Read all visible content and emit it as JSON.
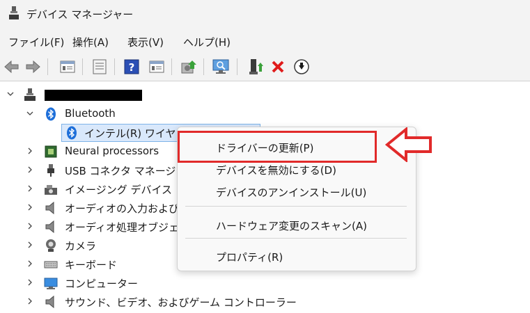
{
  "window": {
    "title": "デバイス マネージャー"
  },
  "menu": [
    "ファイル(F)",
    "操作(A)",
    "表示(V)",
    "ヘルプ(H)"
  ],
  "toolbar": {
    "icons": [
      "back-arrow-icon",
      "forward-arrow-icon",
      "properties-view-icon",
      "list-view-icon",
      "help-icon",
      "detail-view-icon",
      "update-driver-icon",
      "scan-hardware-icon",
      "enable-device-icon",
      "uninstall-x-icon",
      "download-circle-icon"
    ]
  },
  "tree": {
    "root_label": "",
    "bluetooth": "Bluetooth",
    "bluetooth_child": "インテル(R) ワイヤレ",
    "categories": [
      "Neural processors",
      "USB コネクタ マネージャ",
      "イメージング デバイス",
      "オーディオの入力および出",
      "オーディオ処理オブジェク",
      "カメラ",
      "キーボード",
      "コンピューター",
      "サウンド、ビデオ、およびゲーム コントローラー"
    ]
  },
  "context_menu": {
    "update_driver": "ドライバーの更新(P)",
    "disable_device": "デバイスを無効にする(D)",
    "uninstall_device": "デバイスのアンインストール(U)",
    "scan_hardware": "ハードウェア変更のスキャン(A)",
    "properties": "プロパティ(R)"
  },
  "colors": {
    "highlight": "#e12a2a",
    "accent": "#1e6fd9",
    "selection": "#d9e8fb"
  }
}
